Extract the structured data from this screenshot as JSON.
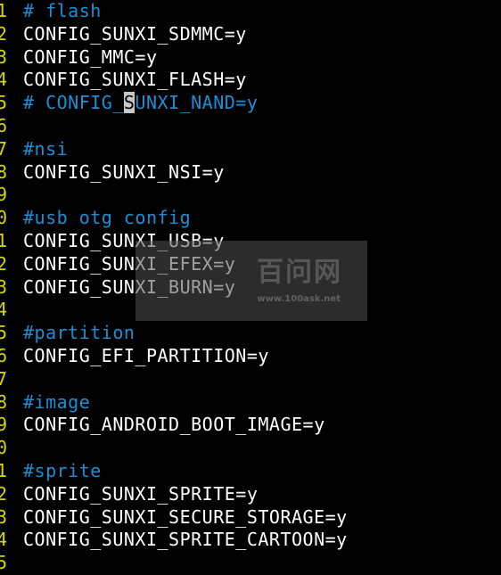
{
  "editor": {
    "lines": [
      {
        "num": "1",
        "text": "# flash",
        "kind": "comment"
      },
      {
        "num": "2",
        "text": "CONFIG_SUNXI_SDMMC=y",
        "kind": "code"
      },
      {
        "num": "3",
        "text": "CONFIG_MMC=y",
        "kind": "code"
      },
      {
        "num": "4",
        "text": "CONFIG_SUNXI_FLASH=y",
        "kind": "code"
      },
      {
        "num": "5",
        "text_before_cursor": "# CONFIG_",
        "cursor_char": "S",
        "text_after_cursor": "UNXI_NAND=y",
        "kind": "comment"
      },
      {
        "num": "6",
        "text": "",
        "kind": "code"
      },
      {
        "num": "7",
        "text": "#nsi",
        "kind": "comment"
      },
      {
        "num": "8",
        "text": "CONFIG_SUNXI_NSI=y",
        "kind": "code"
      },
      {
        "num": "9",
        "text": "",
        "kind": "code"
      },
      {
        "num": "0",
        "text": "#usb otg config",
        "kind": "comment"
      },
      {
        "num": "1",
        "text": "CONFIG_SUNXI_USB=y",
        "kind": "code"
      },
      {
        "num": "2",
        "text": "CONFIG_SUNXI_EFEX=y",
        "kind": "code"
      },
      {
        "num": "3",
        "text": "CONFIG_SUNXI_BURN=y",
        "kind": "code"
      },
      {
        "num": "4",
        "text": "",
        "kind": "code"
      },
      {
        "num": "5",
        "text": "#partition",
        "kind": "comment"
      },
      {
        "num": "6",
        "text": "CONFIG_EFI_PARTITION=y",
        "kind": "code"
      },
      {
        "num": "7",
        "text": "",
        "kind": "code"
      },
      {
        "num": "8",
        "text": "#image",
        "kind": "comment"
      },
      {
        "num": "9",
        "text": "CONFIG_ANDROID_BOOT_IMAGE=y",
        "kind": "code"
      },
      {
        "num": "0",
        "text": "",
        "kind": "code"
      },
      {
        "num": "1",
        "text": "#sprite",
        "kind": "comment"
      },
      {
        "num": "2",
        "text": "CONFIG_SUNXI_SPRITE=y",
        "kind": "code"
      },
      {
        "num": "3",
        "text": "CONFIG_SUNXI_SECURE_STORAGE=y",
        "kind": "code"
      },
      {
        "num": "4",
        "text": "CONFIG_SUNXI_SPRITE_CARTOON=y",
        "kind": "code"
      },
      {
        "num": "5",
        "text": "",
        "kind": "code"
      }
    ]
  },
  "watermark": {
    "title": "百问网",
    "url": "www.100ask.net"
  },
  "colors": {
    "background": "#000000",
    "line_number": "#d7d700",
    "code_text": "#ffffff",
    "comment_text": "#1a8fd6",
    "cursor": "#c8c8c8"
  }
}
